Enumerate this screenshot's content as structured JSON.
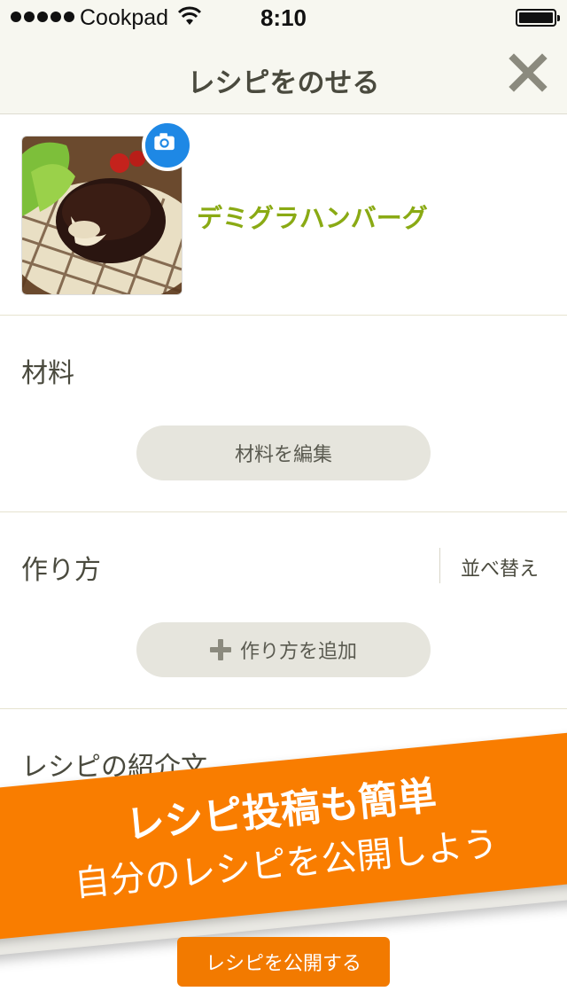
{
  "status_bar": {
    "carrier": "Cookpad",
    "time": "8:10"
  },
  "nav": {
    "title": "レシピをのせる",
    "close_icon": "close-icon"
  },
  "recipe": {
    "title": "デミグラハンバーグ"
  },
  "ingredients": {
    "title": "材料",
    "edit_label": "材料を編集"
  },
  "steps": {
    "title": "作り方",
    "sort_label": "並べ替え",
    "add_label": "作り方を追加"
  },
  "intro": {
    "title": "レシピの紹介文"
  },
  "banner": {
    "line1": "レシピ投稿も簡単",
    "line2": "自分のレシピを公開しよう",
    "color": "#f97d00"
  },
  "publish": {
    "label": "レシピを公開する"
  },
  "colors": {
    "accent_green": "#8aaa14",
    "camera_blue": "#1e88e5",
    "orange": "#f27a00"
  }
}
